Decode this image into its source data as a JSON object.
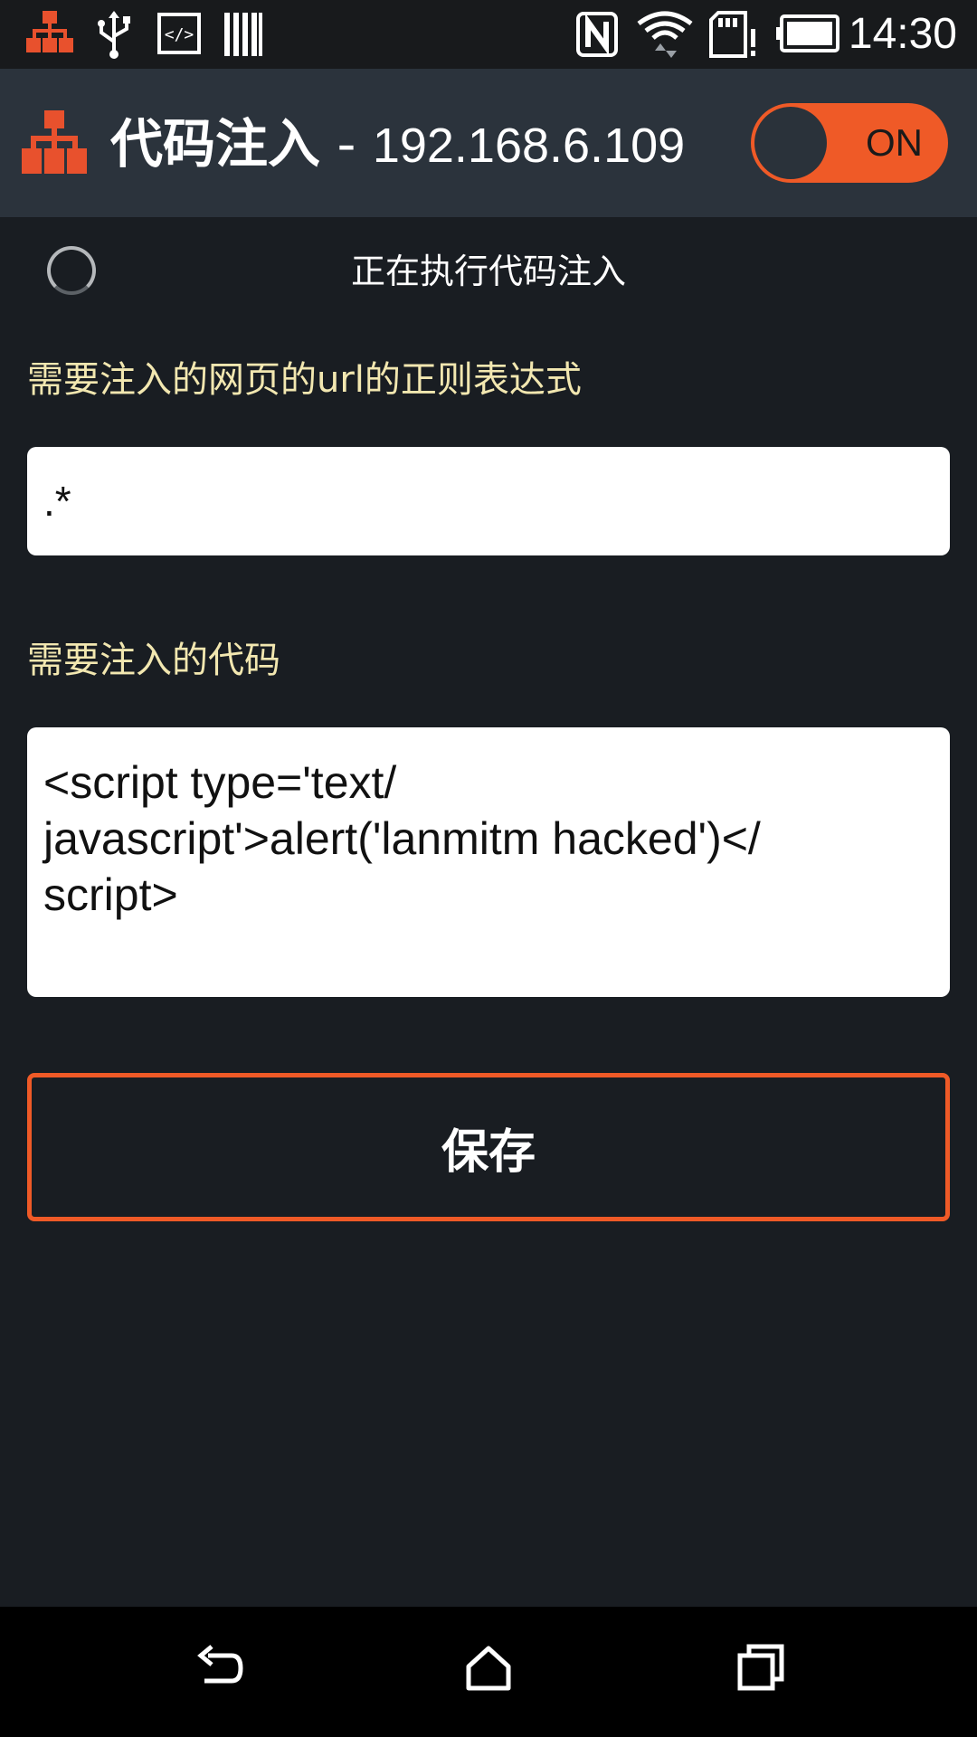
{
  "status_bar": {
    "time": "14:30",
    "icons": [
      "network-app-icon",
      "usb-icon",
      "code-icon",
      "barcode-icon",
      "nfc-icon",
      "wifi-icon",
      "sd-card-alert-icon",
      "battery-icon"
    ]
  },
  "action_bar": {
    "title": "代码注入",
    "separator": " - ",
    "ip": "192.168.6.109",
    "toggle_label": "ON"
  },
  "main": {
    "status_text": "正在执行代码注入",
    "url_regex_label": "需要注入的网页的url的正则表达式",
    "url_regex_value": ".*",
    "code_label": "需要注入的代码",
    "code_value": "<script type='text/\njavascript'>alert('lanmitm hacked')</\nscript>",
    "save_label": "保存"
  },
  "colors": {
    "accent": "#ef5a27",
    "label": "#f2e7b0",
    "background": "#191d22",
    "action_bar": "#2b333c"
  },
  "nav_bar": {
    "icons": [
      "back-icon",
      "home-icon",
      "recents-icon"
    ]
  }
}
